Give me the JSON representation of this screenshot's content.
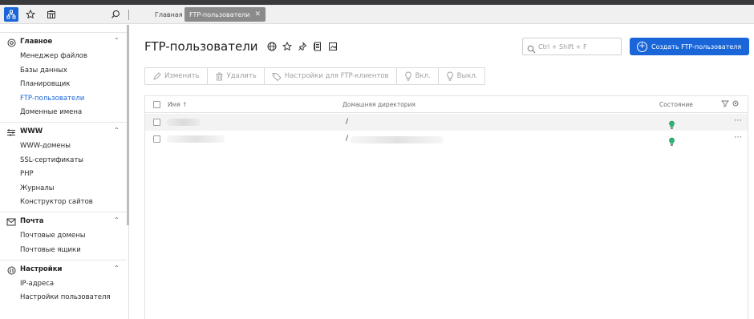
{
  "topbar": {
    "tabs": [
      {
        "label": "Главная",
        "active": false
      },
      {
        "label": "FTP-пользователи",
        "active": true
      }
    ],
    "close_glyph": "✕"
  },
  "sidebar": {
    "groups": [
      {
        "title": "Главное",
        "icon": "dashboard-icon",
        "items": [
          "Менеджер файлов",
          "Базы данных",
          "Планировщик",
          "FTP-пользователи",
          "Доменные имена"
        ],
        "active": "FTP-пользователи"
      },
      {
        "title": "WWW",
        "icon": "www-icon",
        "items": [
          "WWW-домены",
          "SSL-сертификаты",
          "PHP",
          "Журналы",
          "Конструктор сайтов"
        ]
      },
      {
        "title": "Почта",
        "icon": "mail-icon",
        "items": [
          "Почтовые домены",
          "Почтовые ящики"
        ]
      },
      {
        "title": "Настройки",
        "icon": "settings-icon",
        "items": [
          "IP-адреса",
          "Настройки пользователя"
        ]
      }
    ]
  },
  "main": {
    "title": "FTP-пользователи",
    "search_placeholder": "Ctrl + Shift + F",
    "create_button": "Создать FTP-пользователя",
    "toolbar": [
      "Изменить",
      "Удалить",
      "Настройки для FTP-клиентов",
      "Вкл.",
      "Выкл."
    ],
    "table": {
      "columns": {
        "name": "Имя",
        "sort_glyph": "↑",
        "home": "Домашняя директория",
        "status": "Состояние"
      },
      "rows": [
        {
          "home": "/",
          "status": "bulb-icon"
        },
        {
          "home": "/",
          "status": "bulb-icon"
        }
      ]
    }
  },
  "colors": {
    "accent": "#1a66d9",
    "status_green": "#2bb673"
  }
}
